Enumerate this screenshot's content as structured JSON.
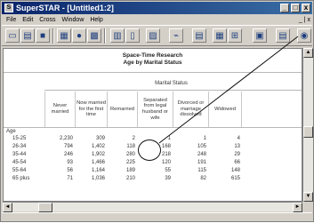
{
  "window": {
    "title": "SuperSTAR - [Untitled1:2]",
    "min": "_",
    "max": "□",
    "close": "x"
  },
  "menu": {
    "items": [
      "File",
      "Edit",
      "Cross",
      "Window",
      "Help"
    ],
    "right_controls": "_ | x"
  },
  "table": {
    "title": "Space-Time Research",
    "subtitle": "Age by Marital Status",
    "column_group": "Marital Status",
    "columns": [
      "Never married",
      "Now married for the first time",
      "Remarried",
      "Separated from legal husband or wife",
      "Divorced or marriage dissolved",
      "Widowed"
    ],
    "row_group": "Age",
    "rows": [
      {
        "label": "15-25",
        "values": [
          "2,230",
          "309",
          "2",
          "1",
          "1",
          "4"
        ]
      },
      {
        "label": "26-34",
        "values": [
          "794",
          "1,402",
          "118",
          "168",
          "105",
          "13"
        ]
      },
      {
        "label": "35-44",
        "values": [
          "246",
          "1,902",
          "280",
          "218",
          "248",
          "29"
        ]
      },
      {
        "label": "45-54",
        "values": [
          "93",
          "1,466",
          "225",
          "120",
          "191",
          "66"
        ]
      },
      {
        "label": "55-64",
        "values": [
          "56",
          "1,164",
          "189",
          "55",
          "115",
          "148"
        ]
      },
      {
        "label": "65 plus",
        "values": [
          "71",
          "1,036",
          "210",
          "39",
          "82",
          "615"
        ]
      }
    ]
  },
  "scroll": {
    "left_arrow": "◄",
    "right_arrow": "►",
    "up_arrow": "▲",
    "down_arrow": "▼"
  }
}
